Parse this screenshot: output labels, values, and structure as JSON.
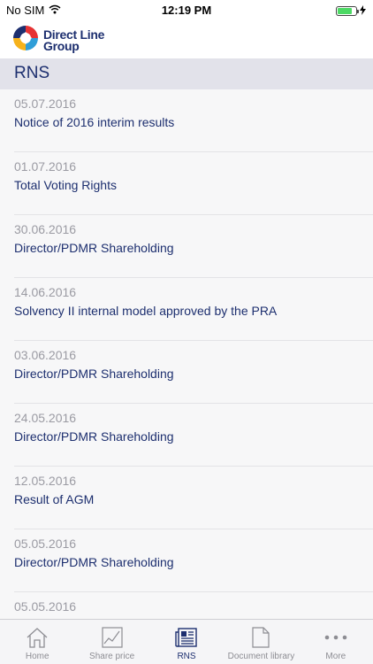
{
  "status_bar": {
    "carrier": "No SIM",
    "time": "12:19 PM",
    "battery_level": 0.8,
    "icons": [
      "wifi-icon",
      "battery-icon",
      "charging-icon"
    ]
  },
  "header": {
    "logo_line1": "Direct Line",
    "logo_line2": "Group",
    "brand_colors": [
      "#e63334",
      "#f6b21b",
      "#2f9ed8",
      "#1d2f6f"
    ]
  },
  "section": {
    "title": "RNS"
  },
  "rns_items": [
    {
      "date": "05.07.2016",
      "title": "Notice of 2016 interim results"
    },
    {
      "date": "01.07.2016",
      "title": "Total Voting Rights"
    },
    {
      "date": "30.06.2016",
      "title": "Director/PDMR Shareholding"
    },
    {
      "date": "14.06.2016",
      "title": "Solvency II internal model approved by the PRA"
    },
    {
      "date": "03.06.2016",
      "title": "Director/PDMR Shareholding"
    },
    {
      "date": "24.05.2016",
      "title": "Director/PDMR Shareholding"
    },
    {
      "date": "12.05.2016",
      "title": "Result of AGM"
    },
    {
      "date": "05.05.2016",
      "title": "Director/PDMR Shareholding"
    },
    {
      "date": "05.05.2016",
      "title": ""
    }
  ],
  "tab_bar": {
    "tabs": [
      {
        "label": "Home",
        "icon": "home-icon",
        "active": false
      },
      {
        "label": "Share price",
        "icon": "share-price-chart-icon",
        "active": false
      },
      {
        "label": "RNS",
        "icon": "news-icon",
        "active": true
      },
      {
        "label": "Document library",
        "icon": "document-icon",
        "active": false
      },
      {
        "label": "More",
        "icon": "more-dots-icon",
        "active": false
      }
    ]
  },
  "colors": {
    "accent": "#1d2f6f",
    "section_bg": "#e2e2ea",
    "inactive_tab": "#8d8d93"
  }
}
